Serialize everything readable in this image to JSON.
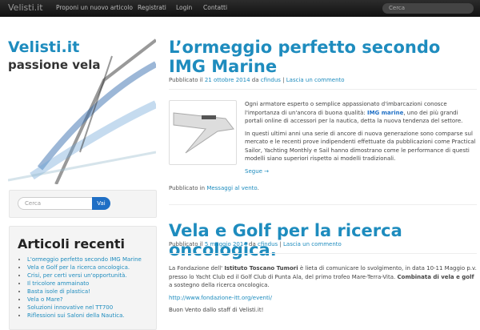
{
  "topbar": {
    "brand": "Velisti.it",
    "nav": [
      "Proponi un nuovo articolo",
      "Registrati",
      "Login",
      "Contatti"
    ],
    "search_placeholder": "Cerca"
  },
  "site": {
    "title": "Velisti.it",
    "tagline": "passione vela"
  },
  "sidebar": {
    "search_placeholder": "Cerca",
    "search_button": "Vai",
    "recent_title": "Articoli recenti",
    "recent": [
      "L'ormeggio perfetto secondo IMG Marine",
      "Vela e Golf per la ricerca oncologica.",
      "Crisi, per certi versi un'opportunità.",
      "Il tricolore ammainato",
      "Basta isole di plastica!",
      "Vela o Mare?",
      "Soluzioni innovative nel TT700",
      "Riflessioni sui Saloni della Nautica."
    ]
  },
  "posts": [
    {
      "title": "L’ormeggio perfetto secondo IMG Marine",
      "meta_prefix": "Pubblicato il ",
      "date": "21 ottobre 2014",
      "by": " da ",
      "author": "cfindus",
      "sep": " | ",
      "comment": "Lascia un commento",
      "p1a": "Ogni armatore esperto o semplice appassionato d'imbarcazioni conosce l'importanza di un'ancora di buona qualità: ",
      "p1b": "IMG marine",
      "p1c": ", uno dei più grandi portali online di accessori per la nautica, detta la nuova tendenza del settore.",
      "p2": "In questi ultimi anni una serie di ancore di nuova generazione sono comparse sul mercato e le recenti prove indipendenti effettuate da pubblicazioni come Practical Sailor, Yachting Monthly e Sail hanno dimostrano come le performance di questi modelli siano superiori rispetto ai modelli tradizionali.",
      "more": "Segue →",
      "cat_prefix": "Pubblicato in ",
      "category": "Messaggi al vento",
      "cat_suffix": "."
    },
    {
      "title": "Vela e Golf per la ricerca oncologica.",
      "meta_prefix": "Pubblicato il ",
      "date": "5 maggio 2014",
      "by": " da ",
      "author": "cfindus",
      "sep": " | ",
      "comment": "Lascia un commento",
      "p1a": "La Fondazione dell' ",
      "p1b": "Istituto Toscano Tumori",
      "p1c": " è lieta di comunicare lo svolgimento, in data 10-11 Maggio p.v. presso lo Yacht Club ed il Golf Club di Punta Ala, del primo trofeo Mare-Terra-Vita. ",
      "p1d": "Combinata di vela e golf",
      "p1e": " a sostegno della ricerca oncologica.",
      "link": "http://www.fondazione-itt.org/eventi/",
      "closing": "Buon Vento dallo staff di Velisti.it!"
    }
  ]
}
